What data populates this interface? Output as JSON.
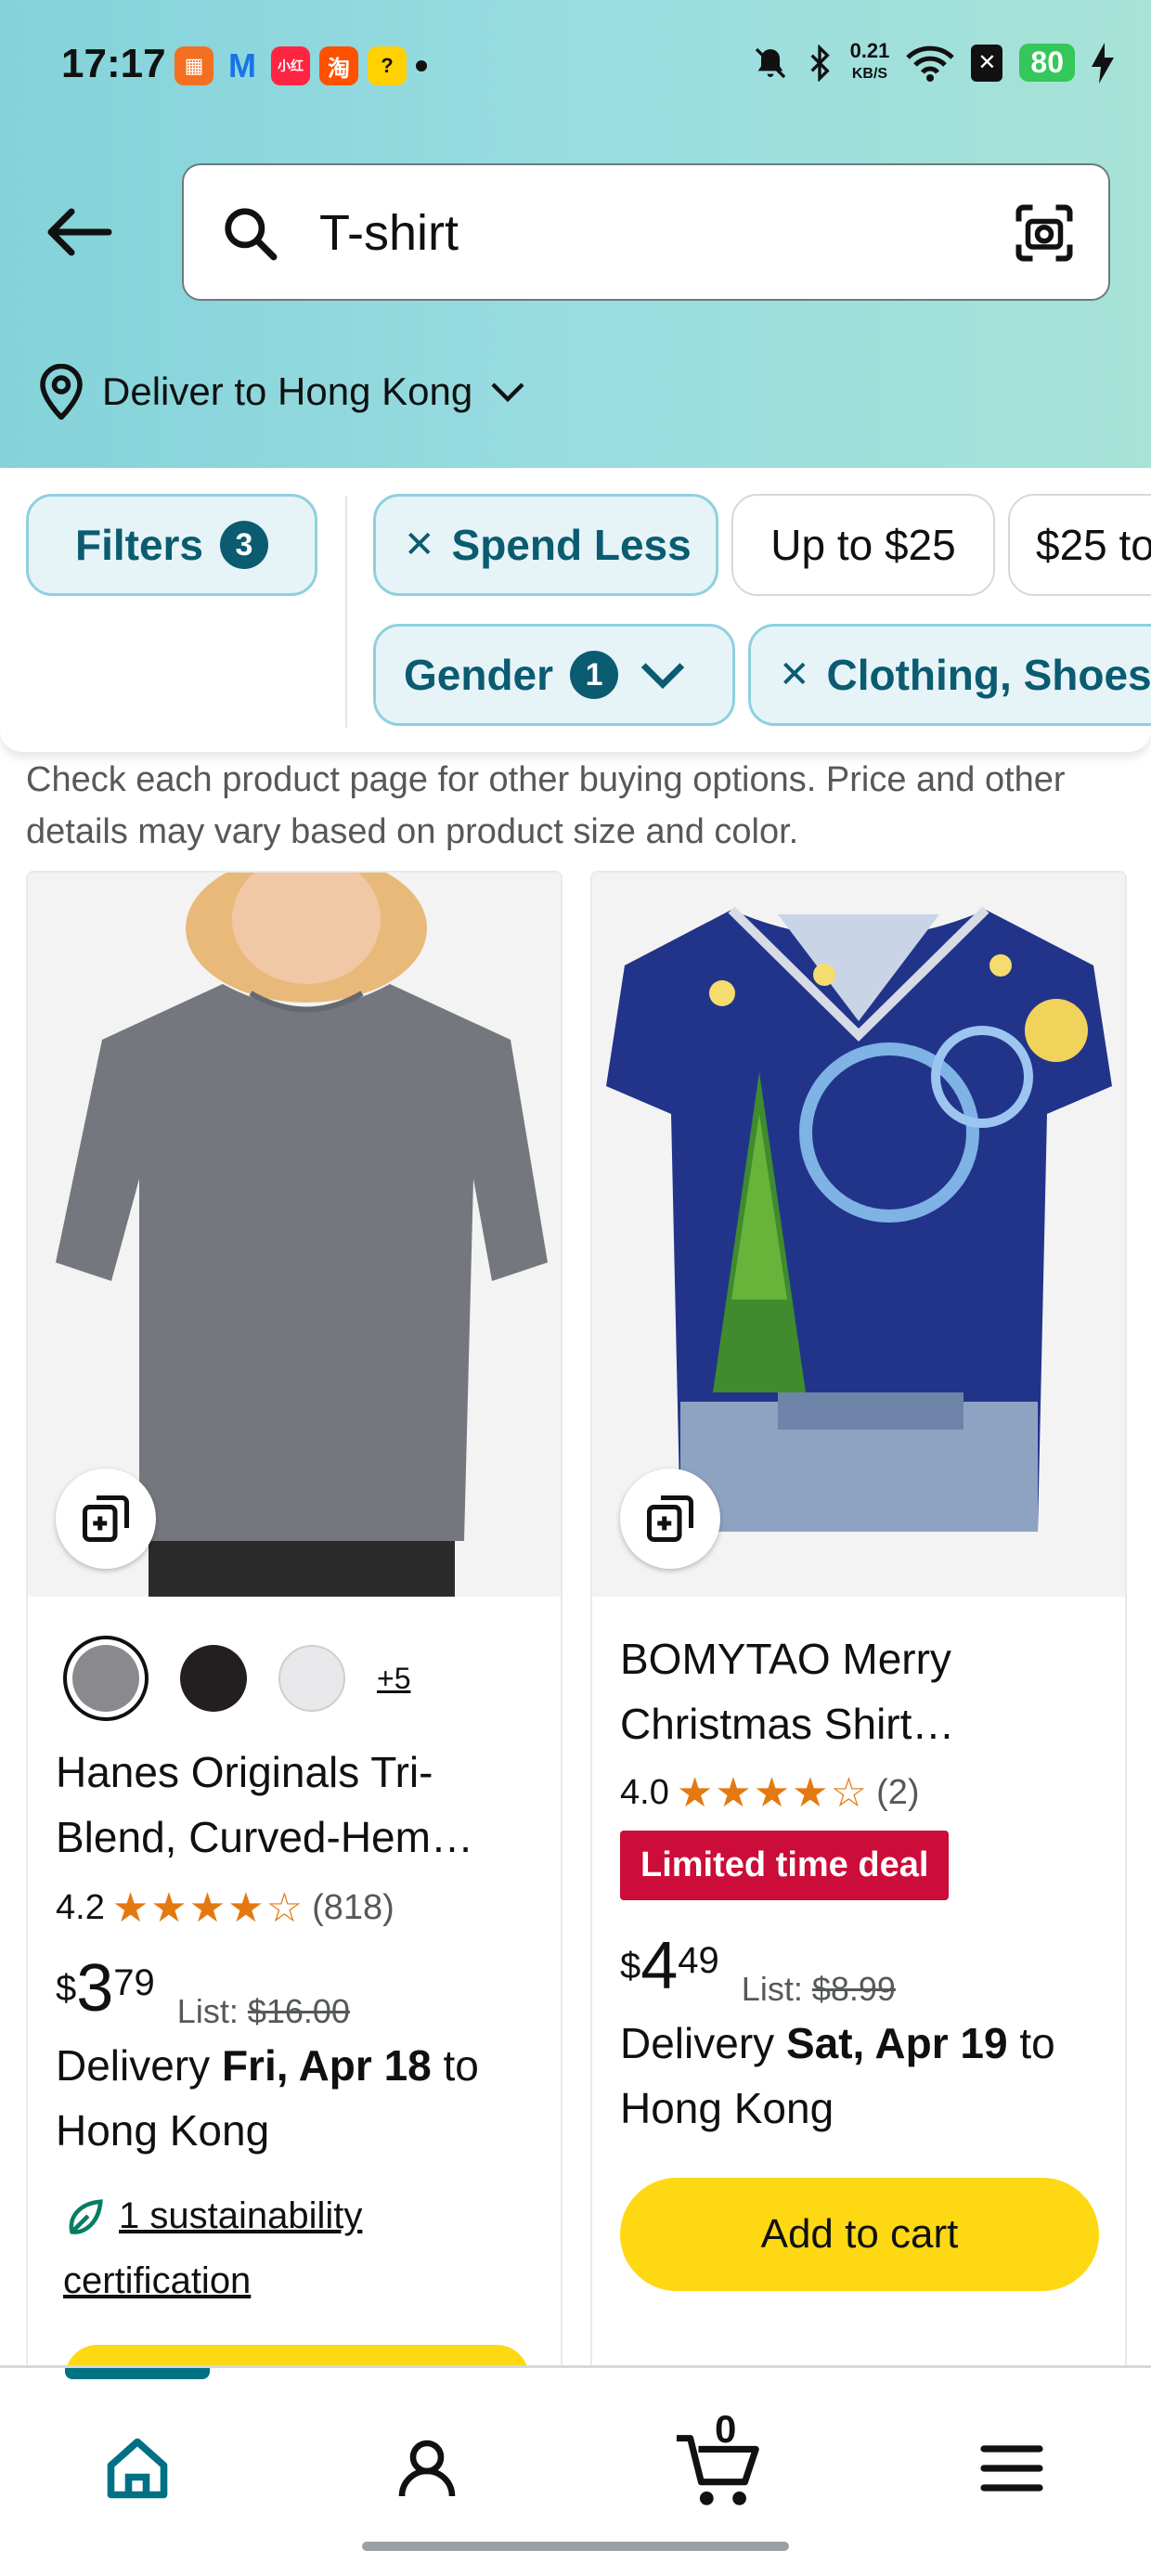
{
  "status_bar": {
    "time": "17:17",
    "notification_icons": [
      "app-icon-1",
      "gmail-icon",
      "xiaohongshu-icon",
      "taobao-icon",
      "meituan-icon"
    ],
    "net_speed_value": "0.21",
    "net_speed_unit": "KB/S",
    "battery": "80"
  },
  "search": {
    "query": "T-shirt"
  },
  "location": {
    "label": "Deliver to Hong Kong"
  },
  "filters": {
    "filters_label": "Filters",
    "filters_count": "3",
    "chips_row1": [
      "Spend Less",
      "Up to $25",
      "$25 to"
    ],
    "gender_label": "Gender",
    "gender_count": "1",
    "category_chip": "Clothing, Shoes"
  },
  "note": "Check each product page for other buying options. Price and other details may vary based on product size and color.",
  "products": [
    {
      "title": "Hanes Originals Tri-Blend, Curved-Hem…",
      "rating": "4.2",
      "stars": "★★★★☆",
      "reviews": "(818)",
      "price_symbol": "$",
      "price_whole": "3",
      "price_fraction": "79",
      "list_label": "List:",
      "list_price": "$16.00",
      "delivery_prefix": "Delivery ",
      "delivery_date": "Fri, Apr 18",
      "delivery_suffix": " to Hong Kong",
      "swatches": [
        "#8a8a8e",
        "#231f20",
        "#e8e8ea"
      ],
      "more_colors": "+5",
      "sustainability": "1 sustainability certification"
    },
    {
      "title": "BOMYTAO Merry Christmas Shirt…",
      "rating": "4.0",
      "stars": "★★★★☆",
      "reviews": "(2)",
      "deal": "Limited time deal",
      "price_symbol": "$",
      "price_whole": "4",
      "price_fraction": "49",
      "list_label": "List:",
      "list_price": "$8.99",
      "delivery_prefix": "Delivery ",
      "delivery_date": "Sat, Apr 19",
      "delivery_suffix": " to Hong Kong",
      "add_to_cart": "Add to cart"
    }
  ],
  "bottom_nav": {
    "cart_count": "0",
    "items": [
      "home-icon",
      "account-icon",
      "cart-icon",
      "menu-icon"
    ]
  },
  "colors": {
    "accent": "#007185",
    "chip_active_text": "#0b5b71",
    "deal_red": "#cc0c39",
    "button_yellow": "#ffd814",
    "star_orange": "#e47911"
  }
}
